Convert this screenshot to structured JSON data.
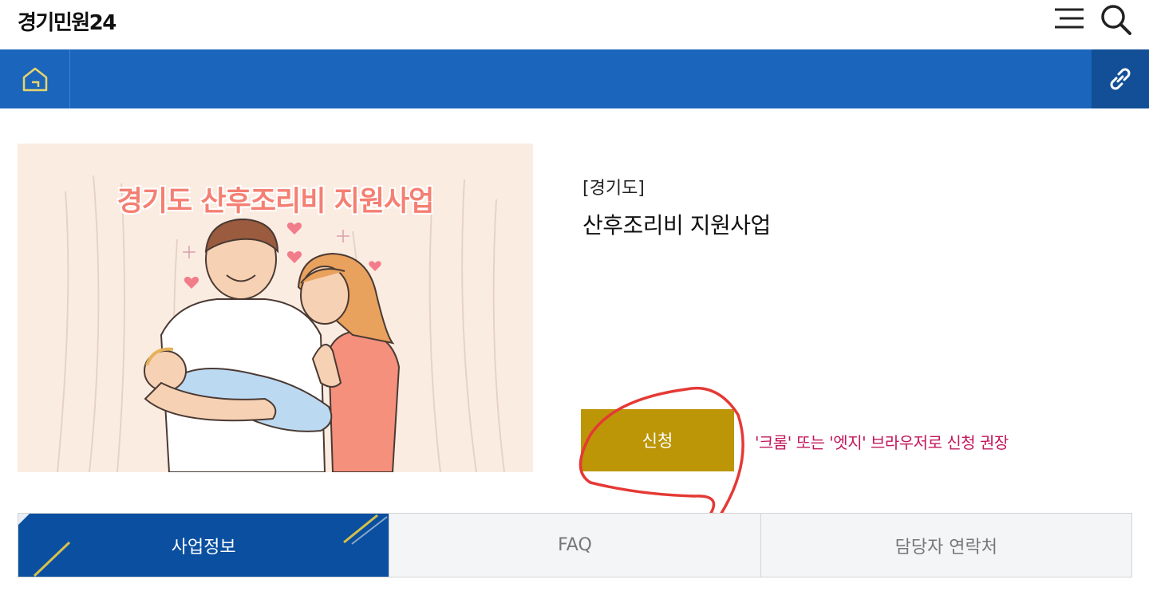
{
  "header": {
    "logo": "경기민원24",
    "menu_icon": "hamburger-icon",
    "search_icon": "search-icon"
  },
  "nav": {
    "home_icon": "home-icon",
    "link_icon": "link-icon",
    "colors": {
      "bar": "#1b66bc",
      "link_box": "#124f96"
    }
  },
  "banner": {
    "title": "경기도 산후조리비 지원사업",
    "illustration": "parents-holding-baby-illustration"
  },
  "service": {
    "region": "[경기도]",
    "title": "산후조리비 지원사업"
  },
  "apply": {
    "button_label": "신청",
    "note": "'크롬' 또는 '엣지' 브라우저로 신청 권장",
    "colors": {
      "button": "#bc9607",
      "note": "#c2185b",
      "annotation": "#e53935"
    }
  },
  "tabs": [
    {
      "label": "사업정보",
      "active": true
    },
    {
      "label": "FAQ",
      "active": false
    },
    {
      "label": "담당자 연락처",
      "active": false
    }
  ]
}
